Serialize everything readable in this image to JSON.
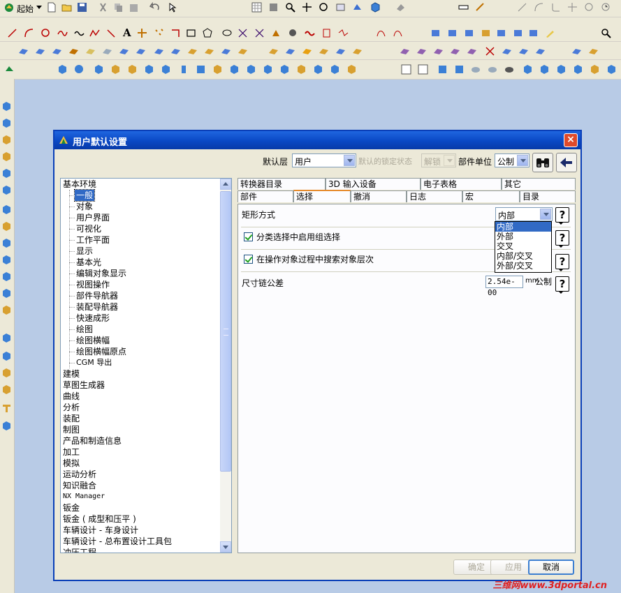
{
  "toolbar": {
    "start_label": "起始"
  },
  "dialog": {
    "title": "用户默认设置",
    "close_label": "×",
    "default_layer_label": "默认层",
    "default_layer_value": "用户",
    "lock_state_label": "默认的锁定状态",
    "lock_state_value": "解锁",
    "part_unit_label": "部件单位",
    "part_unit_value": "公制"
  },
  "tree": {
    "root": "基本环境",
    "children": [
      "一般",
      "对象",
      "用户界面",
      "可视化",
      "工作平面",
      "显示",
      "基本光",
      "编辑对象显示",
      "视图操作",
      "部件导航器",
      "装配导航器",
      "快速成形",
      "绘图",
      "绘图横幅",
      "绘图横幅原点",
      "CGM 导出"
    ],
    "others": [
      "建模",
      "草图生成器",
      "曲线",
      "分析",
      "装配",
      "制图",
      "产品和制造信息",
      "加工",
      "模拟",
      "运动分析",
      "知识融合",
      "NX Manager",
      "钣金",
      "钣金 ( 成型和压平 )",
      "车辆设计 - 车身设计",
      "车辆设计 - 总布置设计工具包",
      "冲压工程"
    ]
  },
  "tabs": {
    "row1": [
      "转换器目录",
      "3D 输入设备",
      "电子表格",
      "其它"
    ],
    "row2": [
      "部件",
      "选择",
      "撤消",
      "日志",
      "宏",
      "目录"
    ]
  },
  "panel": {
    "rect_mode_label": "矩形方式",
    "rect_mode_value": "内部",
    "rect_mode_options": [
      "内部",
      "外部",
      "交叉",
      "内部/交叉",
      "外部/交叉"
    ],
    "group_select_label": "分类选择中启用组选择",
    "search_hierarchy_label": "在操作对象过程中搜索对象层次",
    "chain_tol_label": "尺寸链公差",
    "chain_tol_value": "2.54e-00",
    "chain_tol_unit": "mm",
    "chain_tol_unit2": "公制",
    "help_label": "?"
  },
  "buttons": {
    "ok": "确定",
    "apply": "应用",
    "cancel": "取消"
  },
  "watermark": "三维网www.3dportal.cn"
}
